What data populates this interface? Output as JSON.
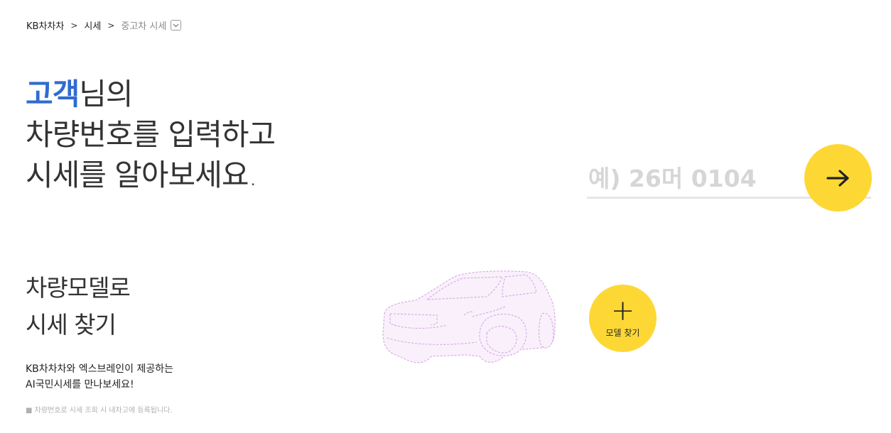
{
  "breadcrumb": {
    "items": [
      "KB차차차",
      "시세",
      "중고차 시세"
    ],
    "sep": ">"
  },
  "hero": {
    "accent": "고객",
    "line1_rest": "님의",
    "line2": "차량번호를 입력하고",
    "line3": "시세를 알아보세요."
  },
  "search": {
    "placeholder": "예) 26머 0104",
    "value": ""
  },
  "model": {
    "title_line1": "차량모델로",
    "title_line2": "시세 찾기",
    "button_label": "모델 찾기",
    "plus": "+"
  },
  "desc": {
    "line1": "KB차차차와 엑스브레인이 제공하는",
    "line2": "AI국민시세를 만나보세요!"
  },
  "note": "■ 차량번호로 시세 조회 시 내차고에 등록됩니다.",
  "colors": {
    "accent": "#2f6bd1",
    "yellow": "#fdd835",
    "car_outline": "#d7a7e3",
    "car_fill": "#f9f0fb"
  }
}
